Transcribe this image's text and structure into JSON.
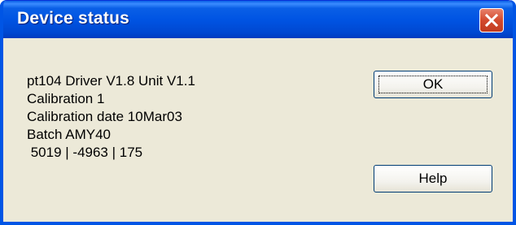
{
  "window": {
    "title": "Device status"
  },
  "info": {
    "lines": [
      "pt104 Driver V1.8 Unit V1.1",
      "Calibration 1",
      "Calibration date 10Mar03",
      "Batch AMY40",
      " 5019 | -4963 | 175"
    ]
  },
  "buttons": {
    "ok_label": "OK",
    "help_label": "Help"
  },
  "icons": {
    "close": "close-icon"
  },
  "colors": {
    "titlebar": "#0054e3",
    "dialog_background": "#ece9d8",
    "close_button": "#d34a2e"
  }
}
